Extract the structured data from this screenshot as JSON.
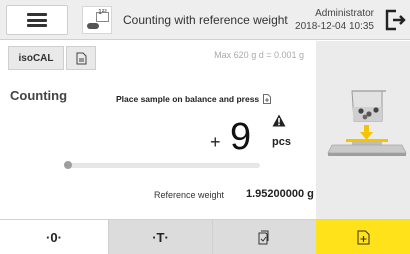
{
  "header": {
    "app_icon_number": "1²³",
    "title": "Counting with reference weight",
    "user": "Administrator",
    "datetime": "2018-12-04  10:35"
  },
  "toolbar": {
    "isocal_label": "isoCAL"
  },
  "limits": "Max 620 g    d = 0.001 g",
  "mode": "Counting",
  "instruction": "Place sample on balance and press",
  "reading": {
    "sign": "+",
    "value": "9",
    "unit": "pcs"
  },
  "progress_fraction": 0.0,
  "reference": {
    "label": "Reference weight",
    "value": "1.95200000 g"
  },
  "bottom": {
    "zero_label": "·0·",
    "tare_label": "·T·"
  },
  "colors": {
    "accent": "#ffe21a",
    "arrow": "#f5c400"
  },
  "icons": [
    "menu-icon",
    "counting-app-icon",
    "logout-icon",
    "document-icon",
    "warning-icon",
    "balance-illustration",
    "document-check-icon",
    "document-add-icon"
  ]
}
